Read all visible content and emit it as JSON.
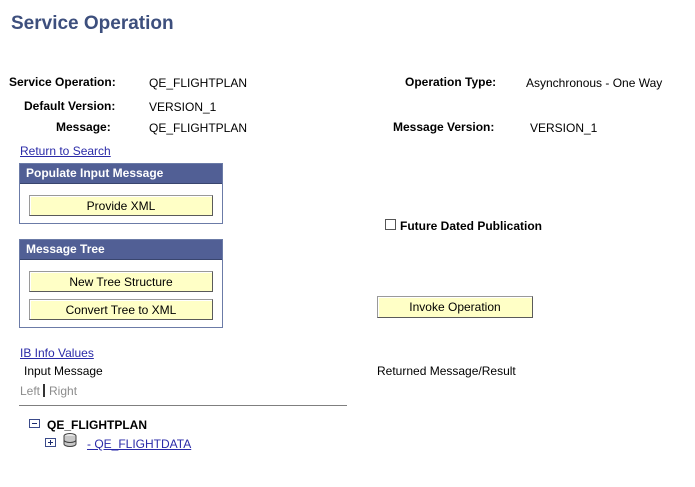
{
  "page_title": "Service Operation",
  "fields": {
    "service_operation_label": "Service Operation:",
    "service_operation_value": "QE_FLIGHTPLAN",
    "default_version_label": "Default Version:",
    "default_version_value": "VERSION_1",
    "message_label": "Message:",
    "message_value": "QE_FLIGHTPLAN",
    "operation_type_label": "Operation Type:",
    "operation_type_value": "Asynchronous - One Way",
    "message_version_label": "Message Version:",
    "message_version_value": "VERSION_1"
  },
  "links": {
    "return_to_search": "Return to Search",
    "ib_info_values": "IB Info Values"
  },
  "populate_box": {
    "header": "Populate Input Message",
    "provide_xml": "Provide XML"
  },
  "tree_box": {
    "header": "Message Tree",
    "new_tree_structure": "New Tree Structure",
    "convert_tree_to_xml": "Convert Tree to XML"
  },
  "future_dated": {
    "label": "Future Dated Publication",
    "checked": false
  },
  "invoke_button": "Invoke Operation",
  "input_message_label": "Input Message",
  "returned_message_label": "Returned Message/Result",
  "tabs": {
    "left": "Left",
    "right": "Right"
  },
  "tree": {
    "root": "QE_FLIGHTPLAN",
    "child": "- QE_FLIGHTDATA"
  }
}
